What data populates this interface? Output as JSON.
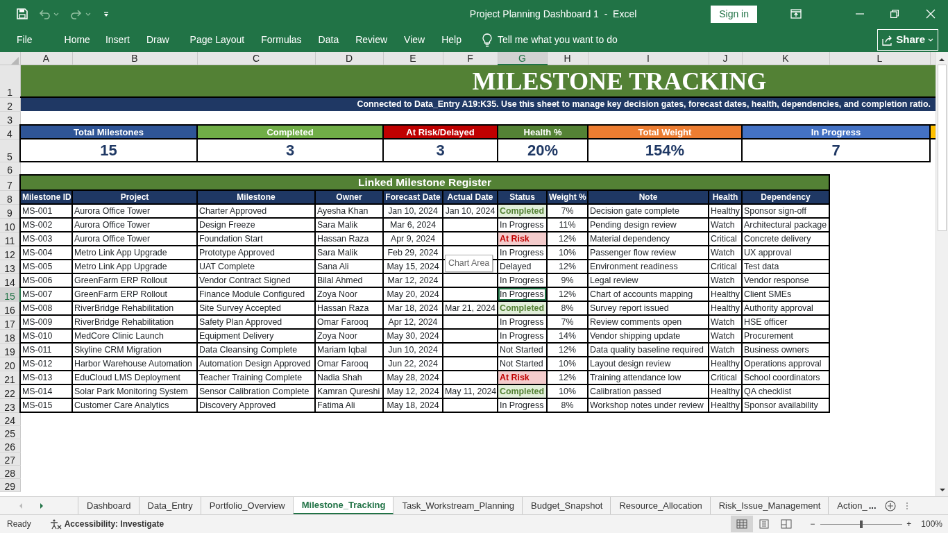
{
  "window": {
    "title": "Project Planning Dashboard 1  -  Excel",
    "sign_in": "Sign in"
  },
  "quick_access": [
    {
      "kind": "save",
      "disabled": false
    },
    {
      "kind": "undo",
      "disabled": true
    },
    {
      "kind": "redo",
      "disabled": true
    },
    {
      "kind": "customize",
      "disabled": false
    }
  ],
  "ribbon_tabs": [
    {
      "label": "File",
      "selected": false
    },
    {
      "label": "Home",
      "selected": false
    },
    {
      "label": "Insert",
      "selected": false
    },
    {
      "label": "Draw",
      "selected": false
    },
    {
      "label": "Page Layout",
      "selected": false
    },
    {
      "label": "Formulas",
      "selected": false
    },
    {
      "label": "Data",
      "selected": false
    },
    {
      "label": "Review",
      "selected": false
    },
    {
      "label": "View",
      "selected": false
    },
    {
      "label": "Help",
      "selected": false
    }
  ],
  "tell_me": "Tell me what you want to do",
  "share": "Share",
  "columns": [
    {
      "letter": "A",
      "selected": false
    },
    {
      "letter": "B",
      "selected": false
    },
    {
      "letter": "C",
      "selected": false
    },
    {
      "letter": "D",
      "selected": false
    },
    {
      "letter": "E",
      "selected": false
    },
    {
      "letter": "F",
      "selected": false
    },
    {
      "letter": "G",
      "selected": true
    },
    {
      "letter": "H",
      "selected": false
    },
    {
      "letter": "I",
      "selected": false
    },
    {
      "letter": "J",
      "selected": false
    },
    {
      "letter": "K",
      "selected": false
    },
    {
      "letter": "L",
      "selected": false
    }
  ],
  "row_numbers": [
    {
      "label": "1",
      "selected": false
    },
    {
      "label": "2",
      "selected": false
    },
    {
      "label": "3",
      "selected": false
    },
    {
      "label": "4",
      "selected": false
    },
    {
      "label": "5",
      "selected": false
    },
    {
      "label": "6",
      "selected": false
    },
    {
      "label": "7",
      "selected": false
    },
    {
      "label": "8",
      "selected": false
    },
    {
      "label": "9",
      "selected": false
    },
    {
      "label": "10",
      "selected": false
    },
    {
      "label": "11",
      "selected": false
    },
    {
      "label": "12",
      "selected": false
    },
    {
      "label": "13",
      "selected": false
    },
    {
      "label": "14",
      "selected": false
    },
    {
      "label": "15",
      "selected": true
    },
    {
      "label": "16",
      "selected": false
    },
    {
      "label": "17",
      "selected": false
    },
    {
      "label": "18",
      "selected": false
    },
    {
      "label": "19",
      "selected": false
    },
    {
      "label": "20",
      "selected": false
    },
    {
      "label": "21",
      "selected": false
    },
    {
      "label": "22",
      "selected": false
    },
    {
      "label": "23",
      "selected": false
    },
    {
      "label": "24",
      "selected": false
    },
    {
      "label": "25",
      "selected": false
    },
    {
      "label": "26",
      "selected": false
    },
    {
      "label": "27",
      "selected": false
    },
    {
      "label": "28",
      "selected": false
    },
    {
      "label": "29",
      "selected": false
    }
  ],
  "sheet_title": "MILESTONE TRACKING",
  "sheet_subtitle": "Connected to Data_Entry A19:K35. Use this sheet to manage key decision gates, forecast dates, health, dependencies, and completion ratio.",
  "kpis": [
    {
      "label": "Total Milestones",
      "value": "15",
      "color": "#2f5597"
    },
    {
      "label": "Completed",
      "value": "3",
      "color": "#70ad47"
    },
    {
      "label": "At Risk/Delayed",
      "value": "3",
      "color": "#c00000"
    },
    {
      "label": "Health %",
      "value": "20%",
      "color": "#548235"
    },
    {
      "label": "Total Weight",
      "value": "154%",
      "color": "#ed7d31"
    },
    {
      "label": "In Progress",
      "value": "7",
      "color": "#4472c4"
    },
    {
      "color": "#ffc000"
    }
  ],
  "register": {
    "title": "Linked Milestone Register",
    "columns": [
      "Milestone ID",
      "Project",
      "Milestone",
      "Owner",
      "Forecast Date",
      "Actual Date",
      "Status",
      "Weight %",
      "Note",
      "Health",
      "Dependency"
    ],
    "rows": [
      {
        "id": "MS-001",
        "project": "Aurora Office Tower",
        "milestone": "Charter Approved",
        "owner": "Ayesha Khan",
        "forecast": "Jan 10, 2024",
        "actual": "Jan 10, 2024",
        "status": "Completed",
        "kind": "completed",
        "weight": "7%",
        "note": "Decision gate complete",
        "health": "Healthy",
        "dependency": "Sponsor sign-off",
        "selected": false
      },
      {
        "id": "MS-002",
        "project": "Aurora Office Tower",
        "milestone": "Design Freeze",
        "owner": "Sara Malik",
        "forecast": "Mar 6, 2024",
        "status": "In Progress",
        "kind": "plain",
        "weight": "11%",
        "note": "Pending design review",
        "health": "Watch",
        "dependency": "Architectural package",
        "selected": false
      },
      {
        "id": "MS-003",
        "project": "Aurora Office Tower",
        "milestone": "Foundation Start",
        "owner": "Hassan Raza",
        "forecast": "Apr 9, 2024",
        "status": "At Risk",
        "kind": "at_risk",
        "weight": "12%",
        "note": "Material dependency",
        "health": "Critical",
        "dependency": "Concrete delivery",
        "selected": false
      },
      {
        "id": "MS-004",
        "project": "Metro Link App Upgrade",
        "milestone": "Prototype Approved",
        "owner": "Sara Malik",
        "forecast": "Feb 29, 2024",
        "status": "In Progress",
        "kind": "plain",
        "weight": "10%",
        "note": "Passenger flow review",
        "health": "Watch",
        "dependency": "UX approval",
        "selected": false
      },
      {
        "id": "MS-005",
        "project": "Metro Link App Upgrade",
        "milestone": "UAT Complete",
        "owner": "Sana Ali",
        "forecast": "May 15, 2024",
        "status": "Delayed",
        "kind": "plain",
        "weight": "12%",
        "note": "Environment readiness",
        "health": "Critical",
        "dependency": "Test data",
        "selected": false
      },
      {
        "id": "MS-006",
        "project": "GreenFarm ERP Rollout",
        "milestone": "Vendor Contract Signed",
        "owner": "Bilal Ahmed",
        "forecast": "Mar 12, 2024",
        "status": "In Progress",
        "kind": "plain",
        "weight": "9%",
        "note": "Legal review",
        "health": "Watch",
        "dependency": "Vendor response",
        "selected": false
      },
      {
        "id": "MS-007",
        "project": "GreenFarm ERP Rollout",
        "milestone": "Finance Module Configured",
        "owner": "Zoya Noor",
        "forecast": "May 20, 2024",
        "status": "In Progress",
        "kind": "plain",
        "weight": "12%",
        "note": "Chart of accounts mapping",
        "health": "Healthy",
        "dependency": "Client SMEs",
        "selected": true
      },
      {
        "id": "MS-008",
        "project": "RiverBridge Rehabilitation",
        "milestone": "Site Survey Accepted",
        "owner": "Hassan Raza",
        "forecast": "Mar 18, 2024",
        "actual": "Mar 21, 2024",
        "status": "Completed",
        "kind": "completed",
        "weight": "8%",
        "note": "Survey report issued",
        "health": "Healthy",
        "dependency": "Authority approval",
        "selected": false
      },
      {
        "id": "MS-009",
        "project": "RiverBridge Rehabilitation",
        "milestone": "Safety Plan Approved",
        "owner": "Omar Farooq",
        "forecast": "Apr 12, 2024",
        "status": "In Progress",
        "kind": "plain",
        "weight": "7%",
        "note": "Review comments open",
        "health": "Watch",
        "dependency": "HSE officer",
        "selected": false
      },
      {
        "id": "MS-010",
        "project": "MedCore Clinic Launch",
        "milestone": "Equipment Delivery",
        "owner": "Zoya Noor",
        "forecast": "May 30, 2024",
        "status": "In Progress",
        "kind": "plain",
        "weight": "14%",
        "note": "Vendor shipping update",
        "health": "Watch",
        "dependency": "Procurement",
        "selected": false
      },
      {
        "id": "MS-011",
        "project": "Skyline CRM Migration",
        "milestone": "Data Cleansing Complete",
        "owner": "Mariam Iqbal",
        "forecast": "Jun 10, 2024",
        "status": "Not Started",
        "kind": "plain",
        "weight": "12%",
        "note": "Data quality baseline required",
        "health": "Watch",
        "dependency": "Business owners",
        "selected": false
      },
      {
        "id": "MS-012",
        "project": "Harbor Warehouse Automation",
        "milestone": "Automation Design Approved",
        "owner": "Omar Farooq",
        "forecast": "Jun 22, 2024",
        "status": "Not Started",
        "kind": "plain",
        "weight": "10%",
        "note": "Layout design review",
        "health": "Healthy",
        "dependency": "Operations approval",
        "selected": false
      },
      {
        "id": "MS-013",
        "project": "EduCloud LMS Deployment",
        "milestone": "Teacher Training Complete",
        "owner": "Nadia Shah",
        "forecast": "May 28, 2024",
        "status": "At Risk",
        "kind": "at_risk",
        "weight": "12%",
        "note": "Training attendance low",
        "health": "Critical",
        "dependency": "School coordinators",
        "selected": false
      },
      {
        "id": "MS-014",
        "project": "Solar Park Monitoring System",
        "milestone": "Sensor Calibration Complete",
        "owner": "Kamran Qureshi",
        "forecast": "May 12, 2024",
        "actual": "May 11, 2024",
        "status": "Completed",
        "kind": "completed",
        "weight": "10%",
        "note": "Calibration passed",
        "health": "Healthy",
        "dependency": "QA checklist",
        "selected": false
      },
      {
        "id": "MS-015",
        "project": "Customer Care Analytics",
        "milestone": "Discovery Approved",
        "owner": "Fatima Ali",
        "forecast": "May 18, 2024",
        "status": "In Progress",
        "kind": "plain",
        "weight": "8%",
        "note": "Workshop notes under review",
        "health": "Healthy",
        "dependency": "Sponsor availability",
        "selected": false
      }
    ]
  },
  "tooltip": "Chart Area",
  "sheet_tabs": [
    {
      "label": "Dashboard",
      "selected": false
    },
    {
      "label": "Data_Entry",
      "selected": false
    },
    {
      "label": "Portfolio_Overview",
      "selected": false
    },
    {
      "label": "Milestone_Tracking",
      "selected": true
    },
    {
      "label": "Task_Workstream_Planning",
      "selected": false
    },
    {
      "label": "Budget_Snapshot",
      "selected": false
    },
    {
      "label": "Resource_Allocation",
      "selected": false
    },
    {
      "label": "Risk_Issue_Management",
      "selected": false
    },
    {
      "label": "Action_",
      "selected": false
    }
  ],
  "more_tabs": "...",
  "status_bar": {
    "ready": "Ready",
    "accessibility": "Accessibility: Investigate",
    "views": [
      {
        "kind": "normal",
        "selected": true
      },
      {
        "kind": "page_layout",
        "selected": false
      },
      {
        "kind": "page_break",
        "selected": false
      }
    ],
    "zoom_out": "−",
    "zoom_in": "+",
    "zoom": {
      "level": 0.5
    },
    "zoom_label": "100%"
  }
}
